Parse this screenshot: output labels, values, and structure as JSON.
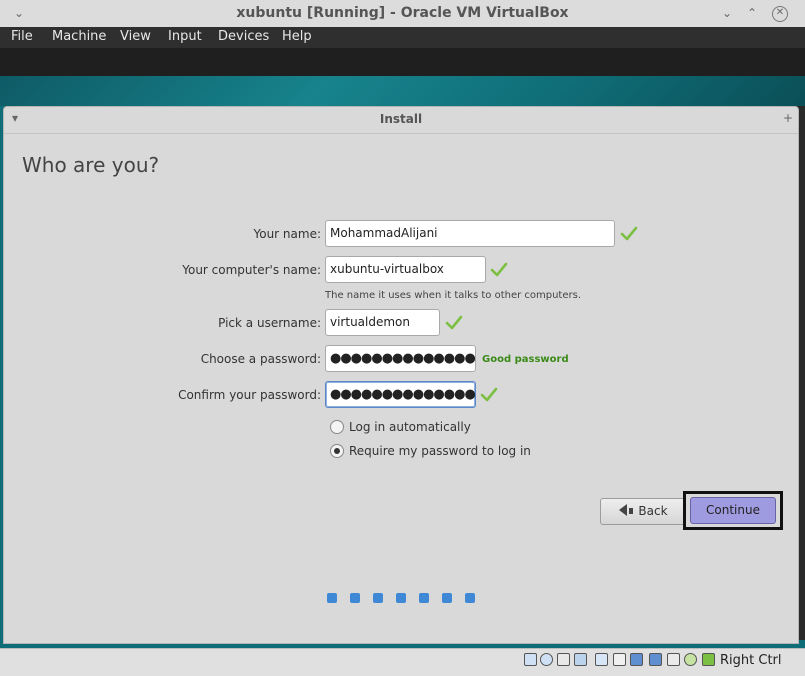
{
  "window": {
    "title": "xubuntu [Running] - Oracle VM VirtualBox",
    "controls": [
      "minimize-icon",
      "maximize-icon",
      "close-icon"
    ]
  },
  "menu": {
    "items": [
      "File",
      "Machine",
      "View",
      "Input",
      "Devices",
      "Help"
    ]
  },
  "dialog": {
    "title": "Install",
    "heading": "Who are you?",
    "fields": {
      "name_label": "Your name:",
      "name_value": "MohammadAlijani",
      "computer_label": "Your computer's name:",
      "computer_value": "xubuntu-virtualbox",
      "computer_hint": "The name it uses when it talks to other computers.",
      "username_label": "Pick a username:",
      "username_value": "virtualdemon",
      "password_label": "Choose a password:",
      "password_value": "●●●●●●●●●●●●●●●",
      "password_strength": "Good password",
      "confirm_label": "Confirm your password:",
      "confirm_value": "●●●●●●●●●●●●●●●"
    },
    "login_options": {
      "auto": "Log in automatically",
      "require": "Require my password to log in",
      "selected": "require"
    },
    "buttons": {
      "back": "Back",
      "continue": "Continue"
    },
    "progress": {
      "steps": 7
    }
  },
  "statusbar": {
    "host_key": "Right Ctrl",
    "icons": [
      "hard-disk-icon",
      "optical-drive-icon",
      "audio-icon",
      "network-icon",
      "usb-icon",
      "shared-folder-icon",
      "display-icon",
      "video-capture-icon",
      "vrde-icon",
      "cpu-icon",
      "mouse-integration-icon",
      "host-key-arrow-icon"
    ]
  },
  "colors": {
    "accent_check": "#7cc043",
    "good_password": "#3a8a18",
    "continue_bg": "#9f9be0",
    "progress_dot": "#3f88d6"
  }
}
